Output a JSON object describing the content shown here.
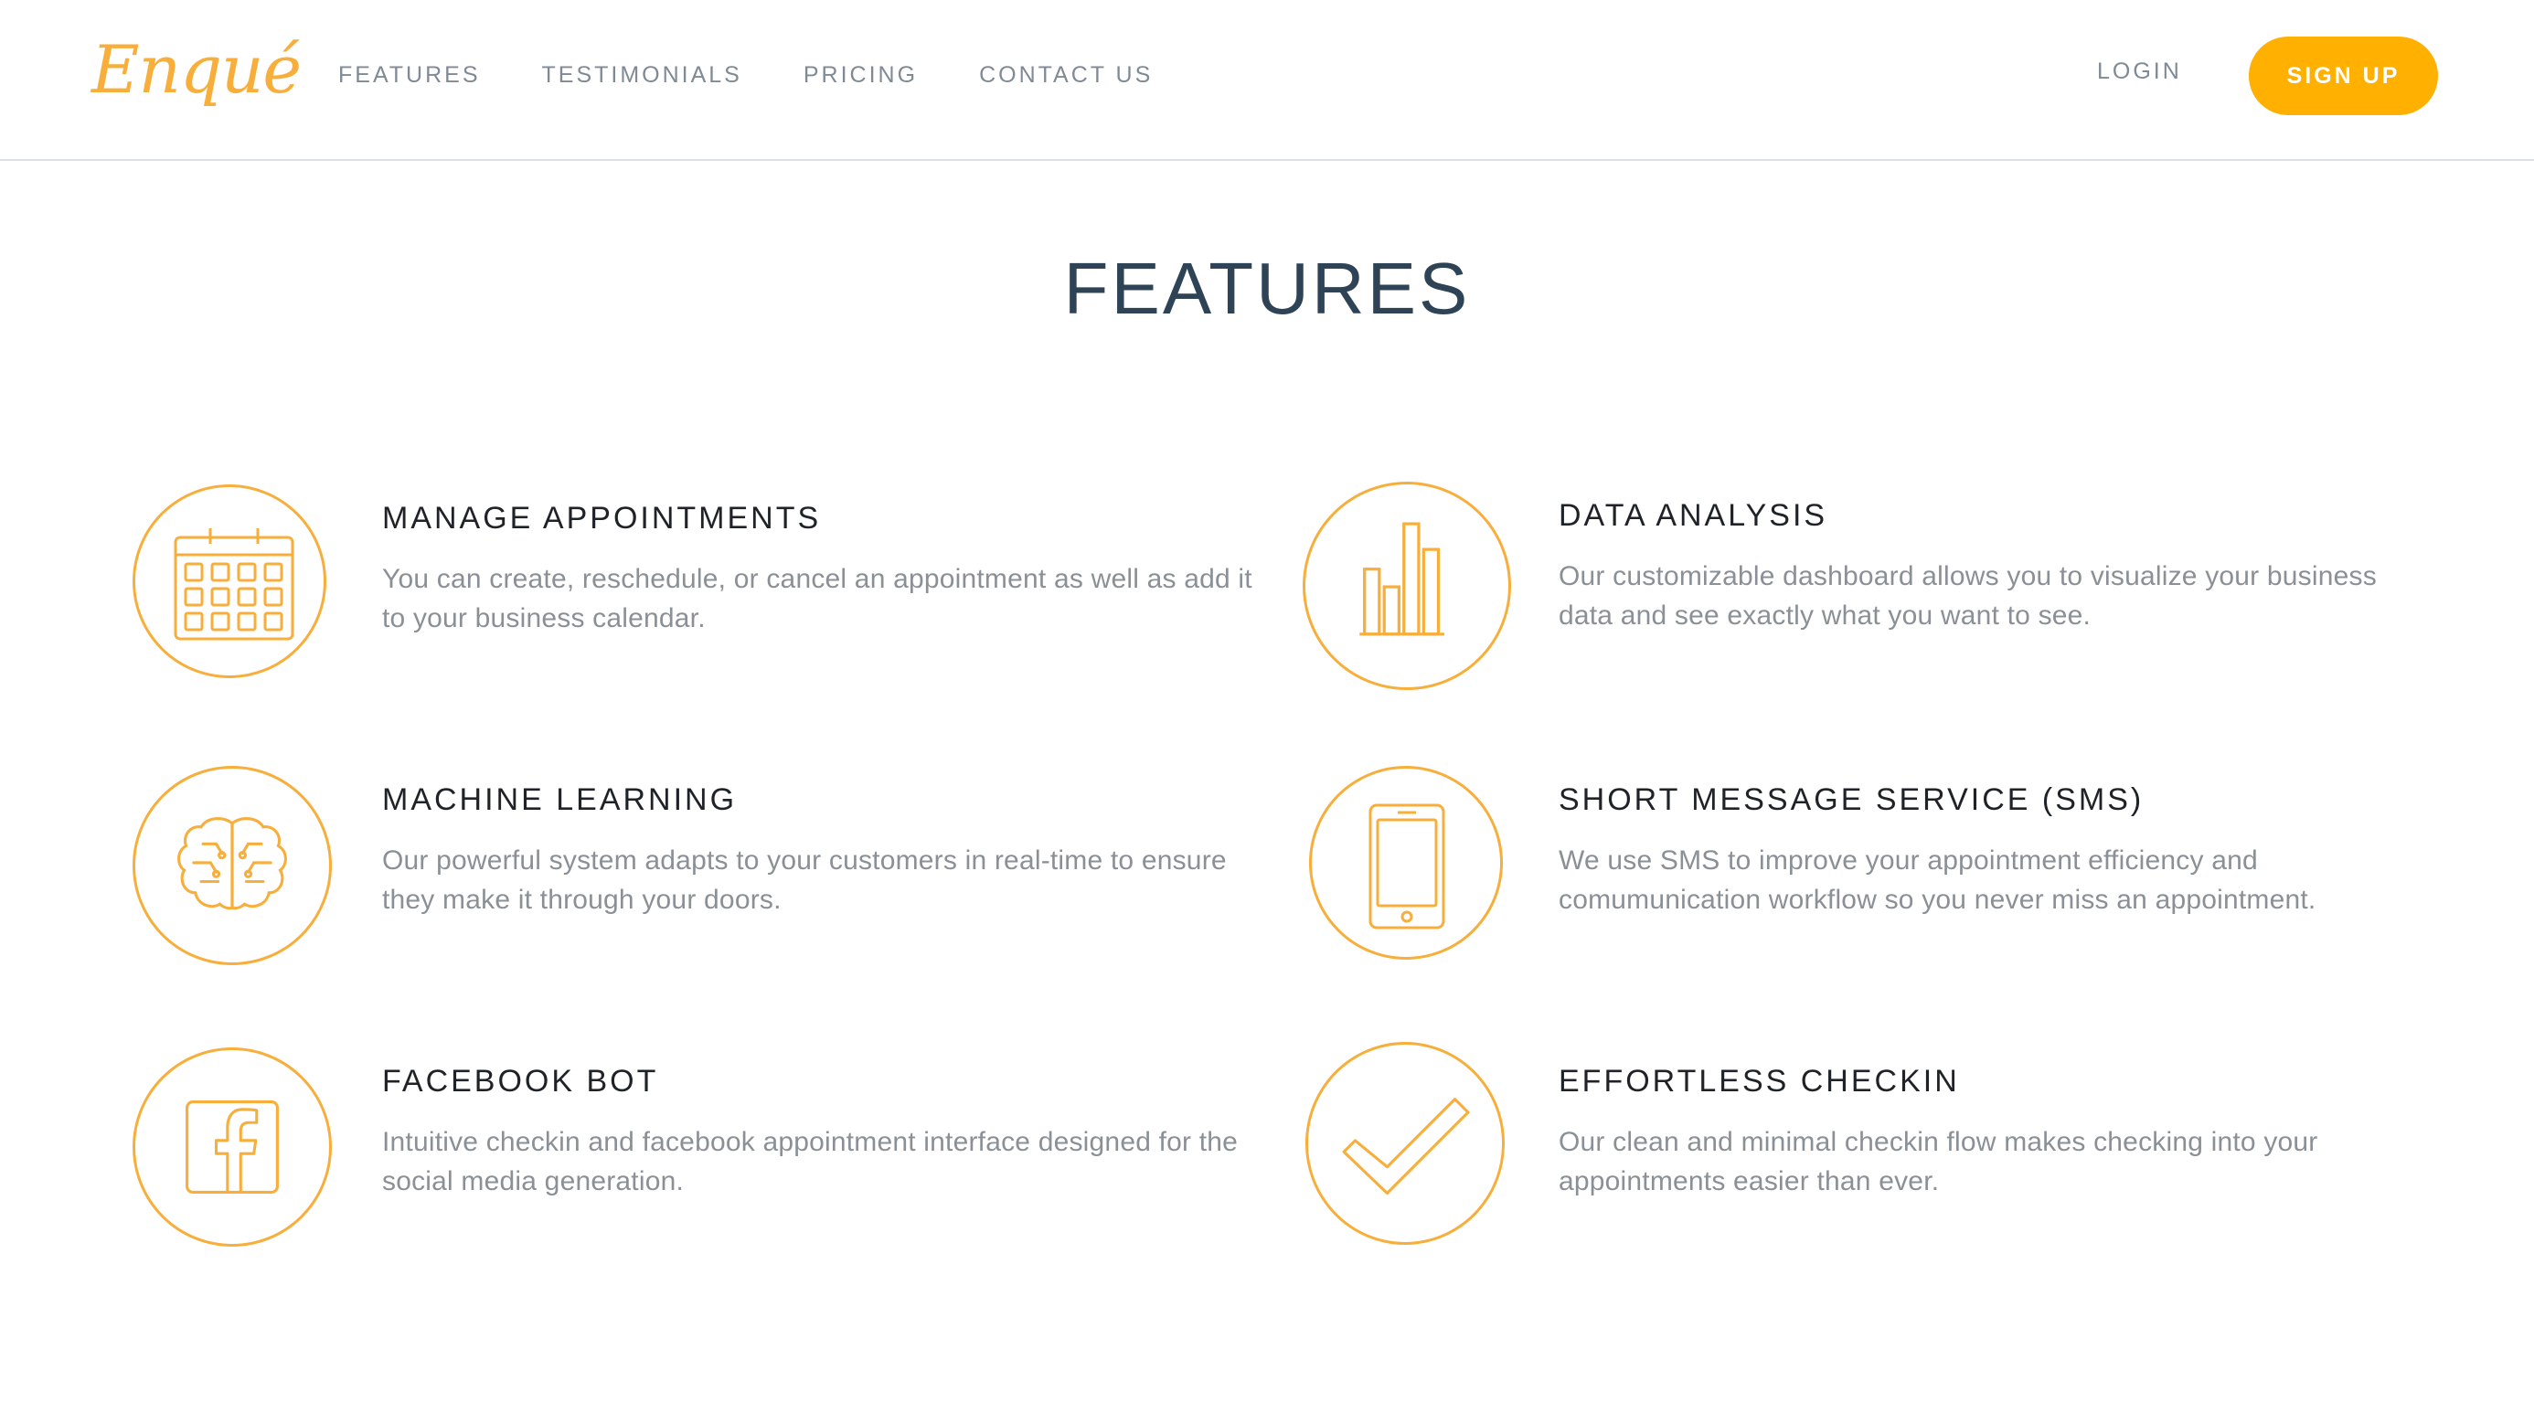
{
  "brand": {
    "logo_text": "Enqué",
    "accent_color": "#f7ae3b",
    "button_color": "#ffb000"
  },
  "nav": {
    "items": [
      {
        "label": "FEATURES"
      },
      {
        "label": "TESTIMONIALS"
      },
      {
        "label": "PRICING"
      },
      {
        "label": "CONTACT US"
      }
    ],
    "login_label": "LOGIN",
    "signup_label": "SIGN UP"
  },
  "section": {
    "title": "FEATURES"
  },
  "features": [
    {
      "icon": "calendar-icon",
      "title": "MANAGE APPOINTMENTS",
      "description": "You can create, reschedule, or cancel an appointment as well as add it to your business calendar."
    },
    {
      "icon": "bar-chart-icon",
      "title": "DATA ANALYSIS",
      "description": "Our customizable dashboard allows you to visualize your business data and see exactly what you want to see."
    },
    {
      "icon": "brain-icon",
      "title": "MACHINE LEARNING",
      "description": "Our powerful system adapts to your customers in real-time to ensure they make it through your doors."
    },
    {
      "icon": "smartphone-icon",
      "title": "SHORT MESSAGE SERVICE (SMS)",
      "description": "We use SMS to improve your appointment efficiency and comumunication workflow so you never miss an appointment."
    },
    {
      "icon": "facebook-icon",
      "title": "FACEBOOK BOT",
      "description": "Intuitive checkin and facebook appointment interface designed for the social media generation."
    },
    {
      "icon": "checkmark-icon",
      "title": "EFFORTLESS CHECKIN",
      "description": "Our clean and minimal checkin flow makes checking into your appointments easier than ever."
    }
  ]
}
